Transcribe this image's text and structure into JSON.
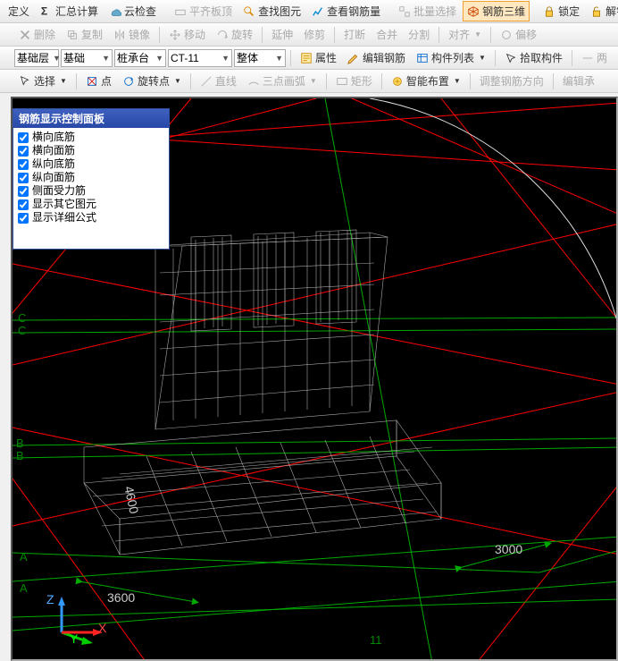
{
  "toolbar1": {
    "define": "定义",
    "summary": "汇总计算",
    "cloud": "云检查",
    "leveltop": "平齐板顶",
    "find": "查找图元",
    "viewrebar": "查看钢筋量",
    "batch": "批量选择",
    "rebar3d": "钢筋三维",
    "lock": "锁定",
    "unlock": "解锁"
  },
  "toolbar2": {
    "delete": "删除",
    "copy": "复制",
    "mirror": "镜像",
    "move": "移动",
    "rotate": "旋转",
    "extend": "延伸",
    "trim": "修剪",
    "break": "打断",
    "merge": "合并",
    "split": "分割",
    "align": "对齐",
    "offset": "偏移"
  },
  "dropdowns": {
    "layer": "基础层",
    "category": "基础",
    "subtype": "桩承台",
    "ct": "CT-11",
    "mode": "整体"
  },
  "toolbar3": {
    "props": "属性",
    "editrebar": "编辑钢筋",
    "complist": "构件列表",
    "pickcomp": "拾取构件",
    "two": "两"
  },
  "toolbar4": {
    "select": "选择",
    "point": "点",
    "rotpoint": "旋转点",
    "line": "直线",
    "arc3": "三点画弧",
    "rect": "矩形",
    "smart": "智能布置",
    "adjdir": "调整钢筋方向",
    "editcap": "编辑承"
  },
  "panel": {
    "title": "钢筋显示控制面板",
    "items": [
      "横向底筋",
      "横向面筋",
      "纵向底筋",
      "纵向面筋",
      "侧面受力筋",
      "显示其它图元",
      "显示详细公式"
    ]
  },
  "viewport": {
    "dim1": "3600",
    "dim2": "3000",
    "dim3": "4600",
    "axisA": "A",
    "axisB": "B",
    "axisC": "C",
    "axis11": "11",
    "coordZ": "Z",
    "coordY": "Y",
    "coordX": "X"
  }
}
